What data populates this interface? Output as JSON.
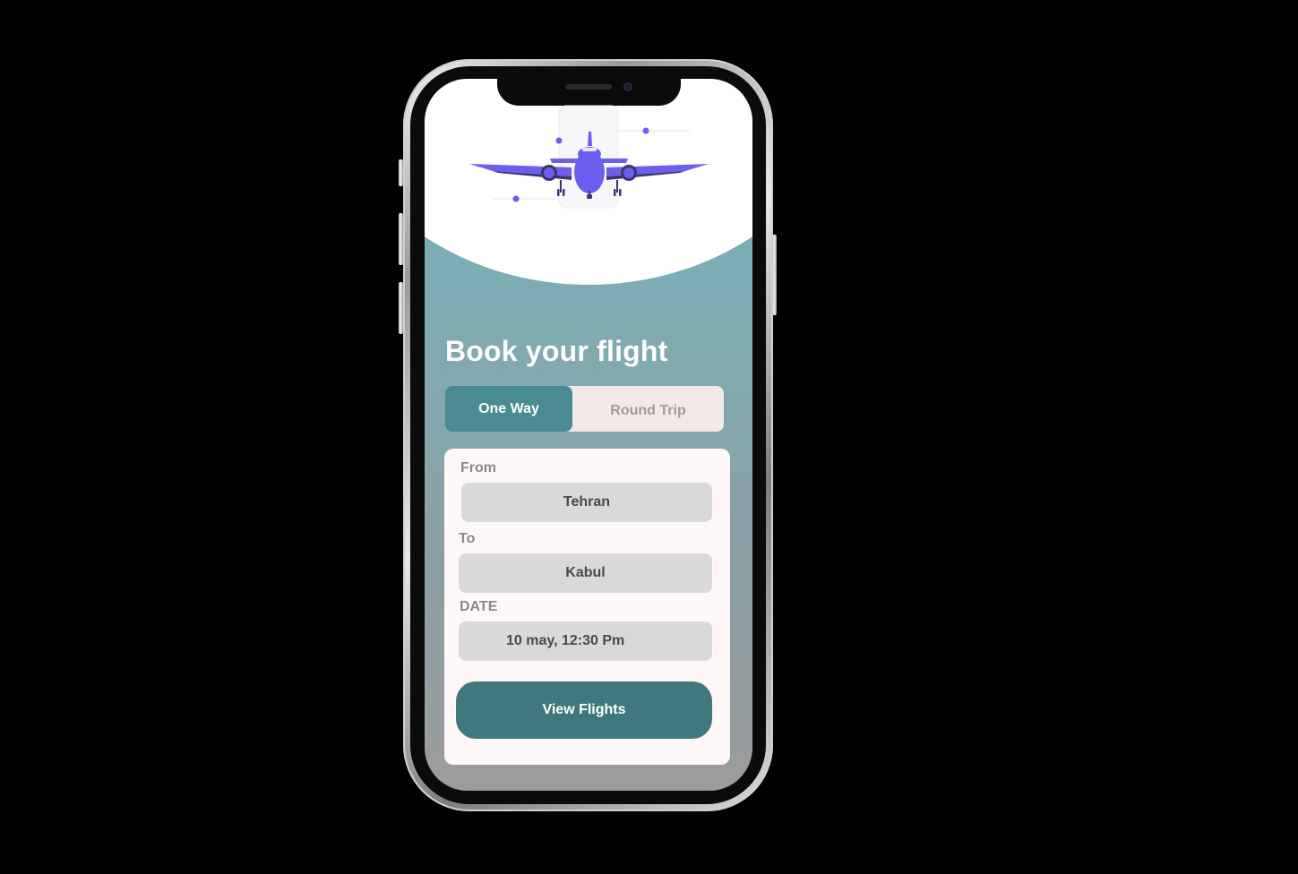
{
  "hero": {
    "icon": "airplane-illustration",
    "accent_color": "#6c5ff0"
  },
  "page": {
    "title": "Book your flight"
  },
  "trip_type": {
    "options": [
      "One Way",
      "Round Trip"
    ],
    "selected": "One Way",
    "active_color": "#4a8a91"
  },
  "form": {
    "from_label": "From",
    "from_value": "Tehran",
    "to_label": "To",
    "to_value": "Kabul",
    "date_label": "DATE",
    "date_value": "10 may, 12:30 Pm"
  },
  "actions": {
    "view_flights_label": "View Flights",
    "button_color": "#40797d"
  }
}
